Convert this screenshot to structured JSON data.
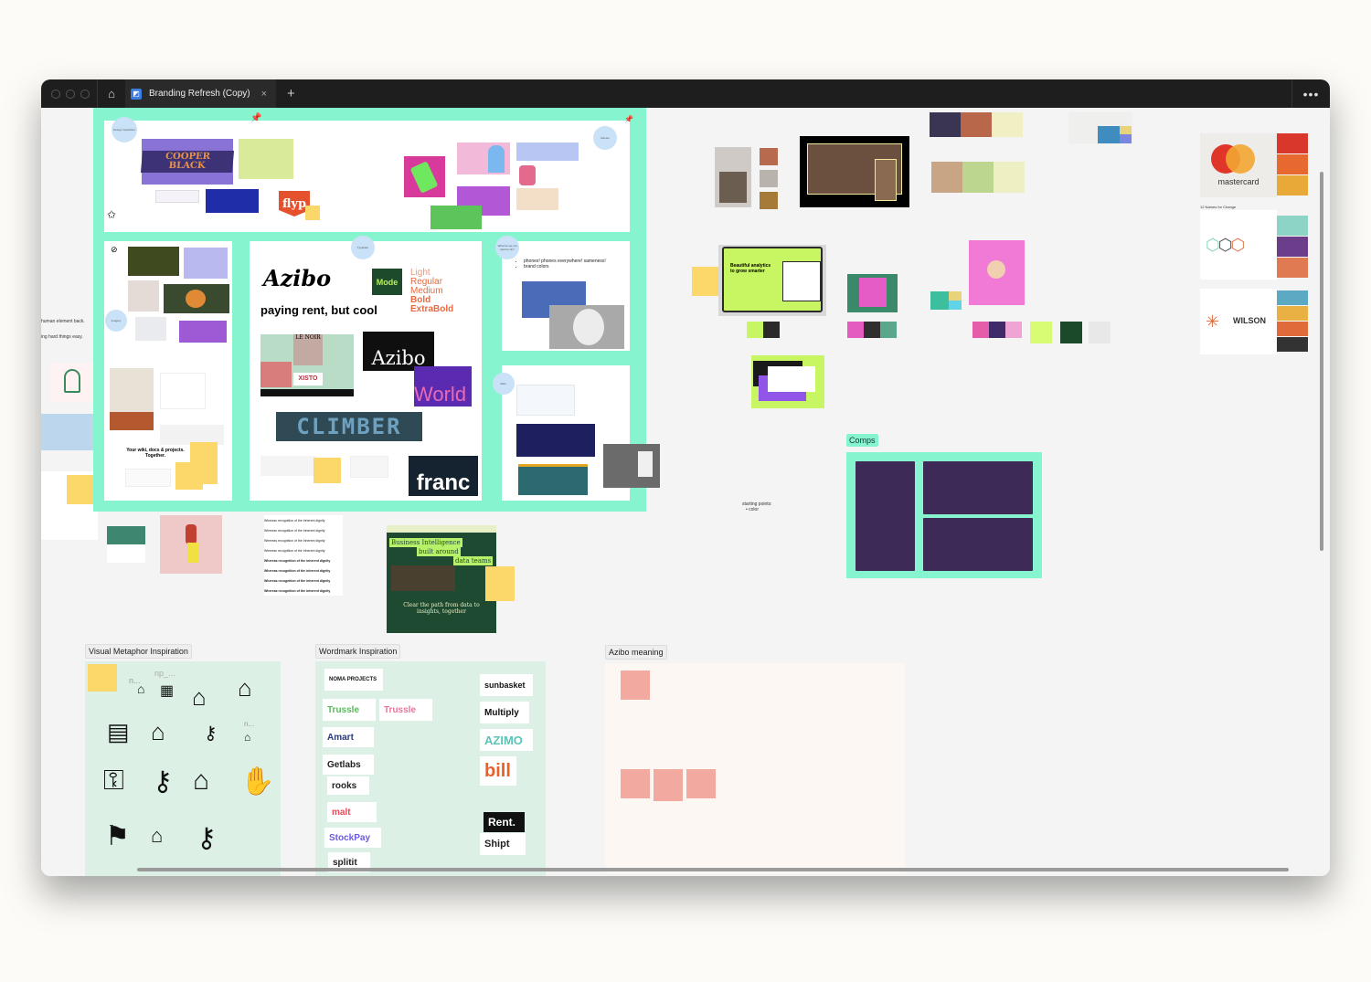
{
  "titlebar": {
    "tab_title": "Branding Refresh (Copy)",
    "close_glyph": "×",
    "new_tab_glyph": "+",
    "home_glyph": "⌂",
    "more_glyph": "•••"
  },
  "board": {
    "inspiration": {
      "circle_design": "Design inspiration",
      "circle_top_right": "Names",
      "circle_imagery": "Imagery",
      "circle_typography": "Typeface",
      "circle_what": "What do we not want to do?",
      "circle_misc": "Misc.",
      "cooper_black": "COOPER BLACK",
      "flyp": "flyp",
      "azibo_script": "Azibo",
      "tagline": "paying rent, but cool",
      "mode": "Mode",
      "weights": [
        "Light",
        "Regular",
        "Medium",
        "Bold",
        "ExtraBold"
      ],
      "azibo_serif": "Azibo",
      "world": "World",
      "climber": "CLIMBER",
      "xisto": "XISTO",
      "le_noir": "LE NOIR",
      "franc": "franc",
      "bullets": [
        "phones! phones everywhere! sameness!",
        "brand colors"
      ],
      "your_wiki": "Your wiki, docs & projects. Together.",
      "left_text_1": "human element back.",
      "left_text_2": "ing hard things easy."
    },
    "right_area": {
      "analytics_title": "Beautiful analytics to grow smarter",
      "mastercard": "mastercard",
      "names_for_change": "12 Names for Change",
      "wilson": "WILSON",
      "starting_points": "starting points:",
      "starting_bullet": "color",
      "comps_label": "Comps"
    },
    "middle": {
      "bi_title": [
        "Business Intelligence",
        "built around",
        "data teams"
      ],
      "bi_sub": "Clear the path from data to insights, together",
      "whereas_lines": [
        "Whereas recognition of the inherent dignity",
        "Whereas recognition of the inherent dignity",
        "Whereas recognition of the inherent dignity",
        "Whereas recognition of the inherent dignity",
        "Whereas recognition of the inherent dignity",
        "Whereas recognition of the inherent dignity",
        "Whereas recognition of the inherent dignity",
        "Whereas recognition of the inherent dignity"
      ]
    },
    "sections": {
      "visual_metaphor": "Visual Metaphor Inspiration",
      "wordmark": "Wordmark Inspiration",
      "azibo_meaning": "Azibo meaning"
    },
    "metaphor_labels": [
      "np_...",
      "n...",
      "n..."
    ],
    "metaphor_icons": [
      "house-pin-icon",
      "apartment-icon",
      "home-icon",
      "calendar-house-icon",
      "certificate-icon",
      "hand-house-dollar-icon",
      "key-icon",
      "small-house-icon",
      "key-tag-icon",
      "keys-icon",
      "house-keys-icon",
      "hand-house-key-icon",
      "for-sale-sign-icon",
      "house-icon",
      "hand-key-icon"
    ],
    "wordmarks_left": [
      "NOMA PROJECTS",
      "Trussle",
      "Trussle",
      "Amart",
      "Getlabs",
      "rooks",
      "malt",
      "StockPay",
      "splitit"
    ],
    "wordmarks_right": [
      "sunbasket",
      "Multiply",
      "AZIMO",
      "bill",
      "Rent.",
      "Shipt"
    ]
  },
  "colors": {
    "mint": "#86f5cf",
    "comps_purple": "#3d2a56",
    "palette_1": [
      "#3a3552",
      "#b8674a",
      "#f1efc4"
    ],
    "palette_2": [
      "#c7a585",
      "#bcd690",
      "#eef0c4"
    ],
    "palette_3": [
      "#b86a4e",
      "#b8b4ad",
      "#a67b3a"
    ],
    "mastercard": [
      "#d9372c",
      "#e8692f",
      "#e9a938"
    ],
    "names_change": [
      "#8ed4c6",
      "#6c3d8a",
      "#e07a52"
    ],
    "wilson": [
      "#5ba9c2",
      "#e9b044",
      "#e06a3a",
      "#333333"
    ]
  }
}
